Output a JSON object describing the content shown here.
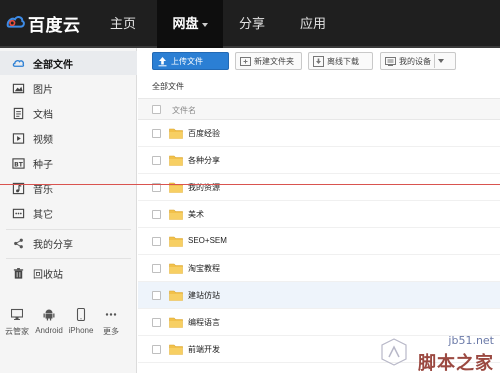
{
  "app": {
    "logo_text": "百度云"
  },
  "nav": [
    {
      "label": "主页",
      "active": false
    },
    {
      "label": "网盘",
      "active": true
    },
    {
      "label": "分享",
      "active": false
    },
    {
      "label": "应用",
      "active": false
    }
  ],
  "sidebar": {
    "items": [
      {
        "label": "全部文件",
        "icon": "cloud-icon",
        "active": true
      },
      {
        "label": "图片",
        "icon": "image-icon",
        "active": false
      },
      {
        "label": "文档",
        "icon": "document-icon",
        "active": false
      },
      {
        "label": "视频",
        "icon": "video-icon",
        "active": false
      },
      {
        "label": "种子",
        "icon": "bt-icon",
        "active": false
      },
      {
        "label": "音乐",
        "icon": "music-icon",
        "active": false
      },
      {
        "label": "其它",
        "icon": "more-icon",
        "active": false
      },
      {
        "label": "我的分享",
        "icon": "share-icon",
        "active": false
      },
      {
        "label": "回收站",
        "icon": "trash-icon",
        "active": false
      }
    ],
    "devices": [
      {
        "label": "云管家",
        "icon": "monitor-icon"
      },
      {
        "label": "Android",
        "icon": "android-icon"
      },
      {
        "label": "iPhone",
        "icon": "iphone-icon"
      },
      {
        "label": "更多",
        "icon": "ellipsis-icon"
      }
    ]
  },
  "toolbar": {
    "upload_label": "上传文件",
    "new_folder_label": "新建文件夹",
    "offline_download_label": "离线下载",
    "my_devices_label": "我的设备"
  },
  "breadcrumb": "全部文件",
  "file_list": {
    "header_label": "文件名",
    "rows": [
      {
        "name": "百度经验"
      },
      {
        "name": "各种分享"
      },
      {
        "name": "我的资源"
      },
      {
        "name": "美术"
      },
      {
        "name": "SEO+SEM"
      },
      {
        "name": "淘宝教程"
      },
      {
        "name": "建站仿站"
      },
      {
        "name": "编程语言"
      },
      {
        "name": "前端开发"
      }
    ]
  },
  "watermark": {
    "site": "jb51.net",
    "brand": "脚本之家"
  },
  "colors": {
    "topbar": "#1f1f1f",
    "accent": "#2b7fd4",
    "folder": "#f2c14a",
    "redline": "#d9534f"
  }
}
